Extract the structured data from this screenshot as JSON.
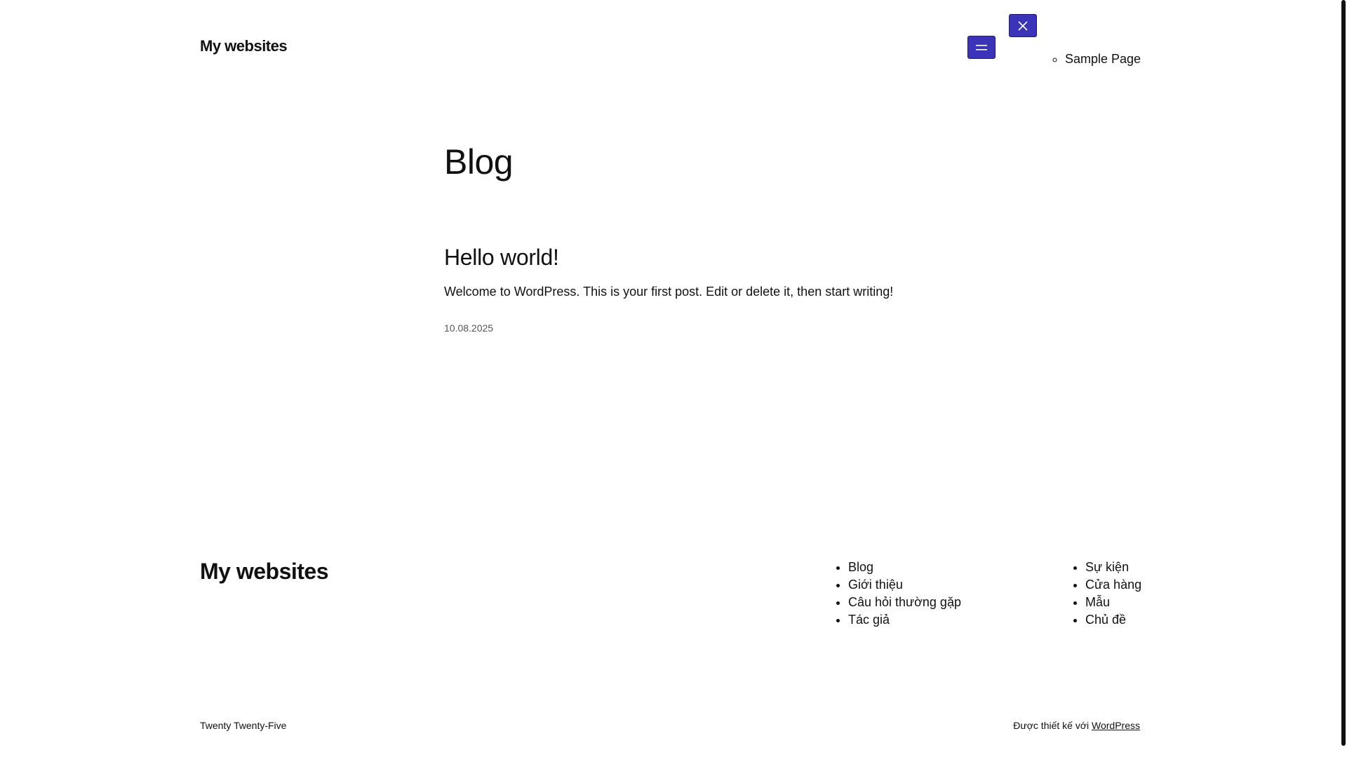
{
  "header": {
    "site_title": "My websites",
    "nav": [
      "Sample Page"
    ]
  },
  "main": {
    "page_title": "Blog",
    "post": {
      "title": "Hello world!",
      "excerpt": "Welcome to WordPress. This is your first post. Edit or delete it, then start writing!",
      "date": "10.08.2025"
    }
  },
  "footer": {
    "site_title": "My websites",
    "nav_col1": [
      "Blog",
      "Giới thiệu",
      "Câu hỏi thường gặp",
      "Tác giả"
    ],
    "nav_col2": [
      "Sự kiện",
      "Cửa hàng",
      "Mẫu",
      "Chủ đề"
    ],
    "theme_name": "Twenty Twenty-Five",
    "credit_prefix": "Được thiết kế với ",
    "credit_link": "WordPress"
  },
  "colors": {
    "button_bg": "#3b33b8",
    "text": "#111111",
    "date_text": "#555555"
  },
  "icons": {
    "menu_open": "hamburger-icon",
    "menu_close": "close-icon"
  }
}
